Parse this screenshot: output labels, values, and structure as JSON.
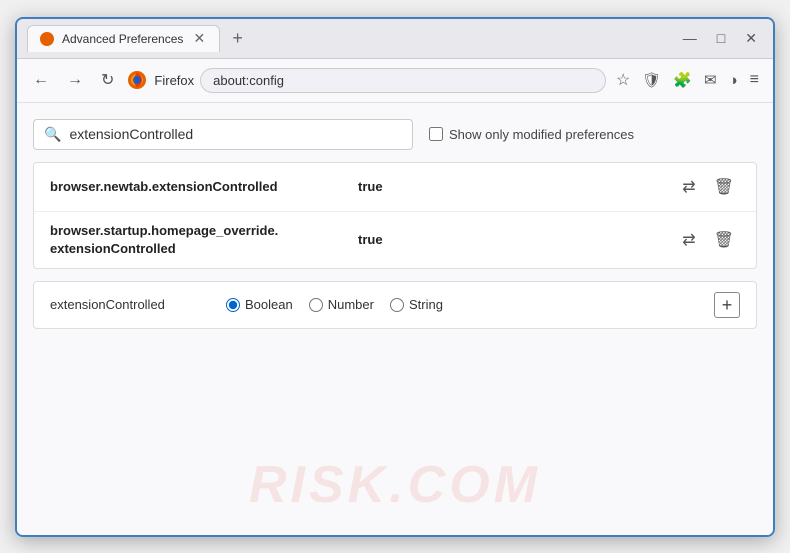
{
  "window": {
    "title": "Advanced Preferences",
    "controls": {
      "minimize": "—",
      "maximize": "□",
      "close": "✕"
    }
  },
  "tab": {
    "label": "Advanced Preferences",
    "new_tab": "+"
  },
  "nav": {
    "back": "←",
    "forward": "→",
    "reload": "↻",
    "browser_name": "Firefox",
    "url": "about:config",
    "bookmark_icon": "☆",
    "shield_icon": "🛡",
    "extension_icon": "🧩",
    "share_icon": "✉",
    "compat_icon": "◑",
    "menu_icon": "≡"
  },
  "search": {
    "placeholder": "extensionControlled",
    "value": "extensionControlled",
    "show_modified_label": "Show only modified preferences"
  },
  "results": [
    {
      "name": "browser.newtab.extensionControlled",
      "value": "true"
    },
    {
      "name": "browser.startup.homepage_override.\nextensionControlled",
      "name_line1": "browser.startup.homepage_override.",
      "name_line2": "extensionControlled",
      "value": "true",
      "multiline": true
    }
  ],
  "add_row": {
    "key": "extensionControlled",
    "type_options": [
      "Boolean",
      "Number",
      "String"
    ],
    "selected_type": "Boolean",
    "add_label": "+"
  },
  "watermark": "RISK.COM",
  "actions": {
    "toggle": "⇄",
    "delete": "🗑"
  }
}
